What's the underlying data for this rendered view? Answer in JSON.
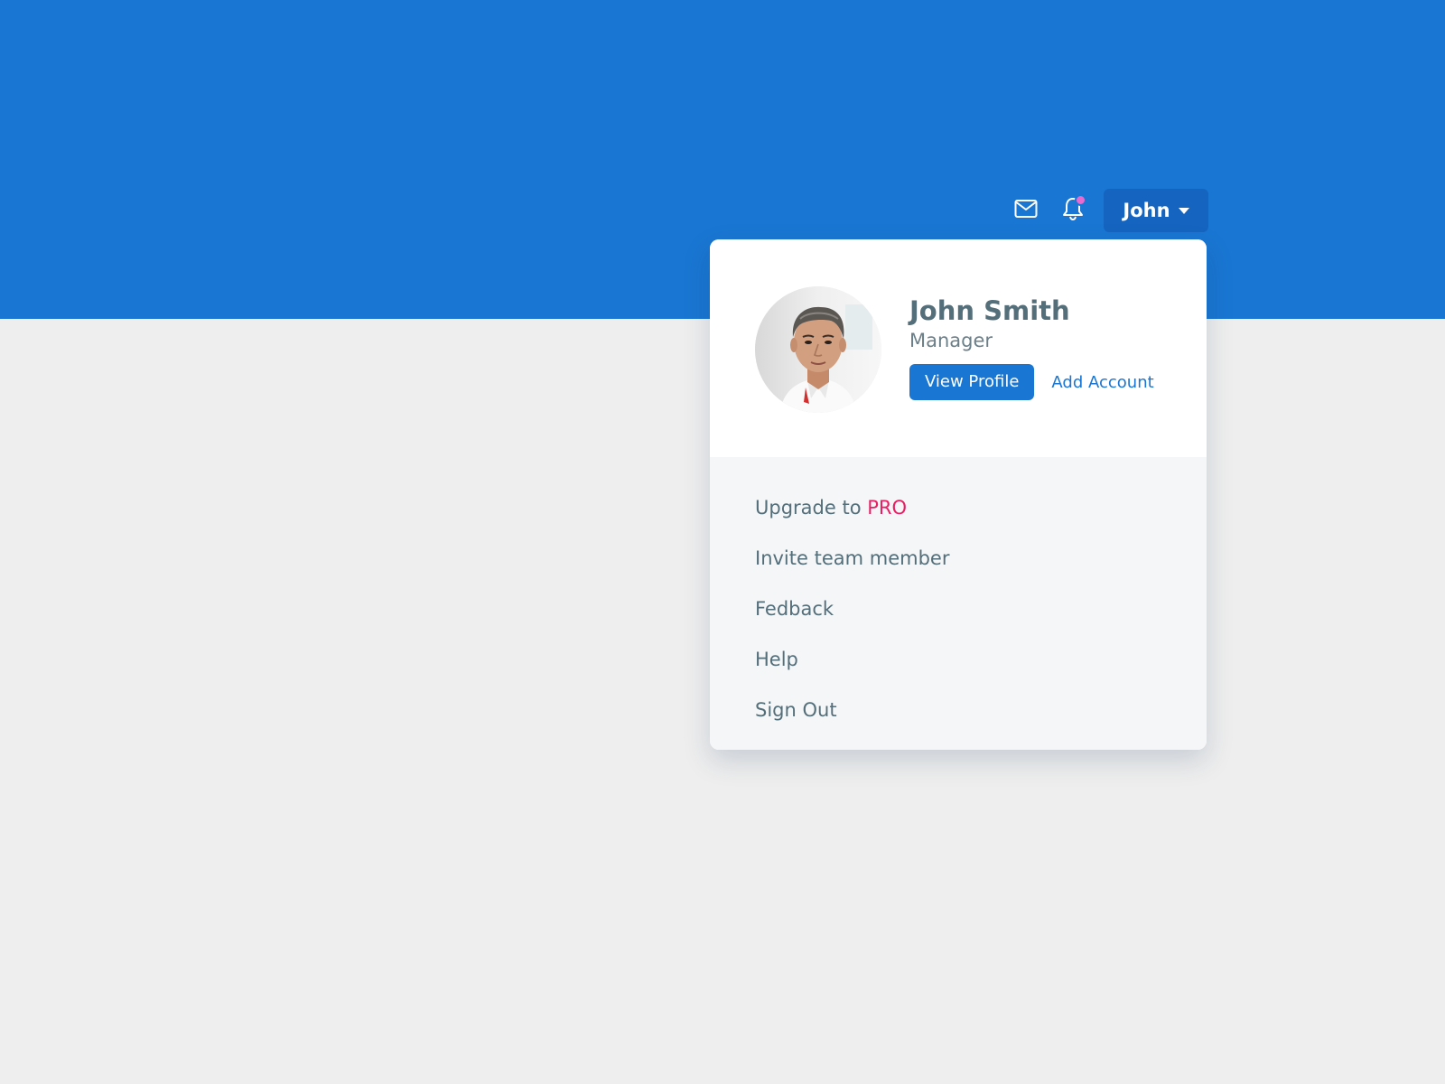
{
  "colors": {
    "primary": "#1976d2",
    "primary_dark": "#1565c0",
    "accent_pro": "#e91e63",
    "notification_dot": "#e66bd0",
    "background": "#eeeeee",
    "text": "#546e7a"
  },
  "topbar": {
    "mail_icon": "envelope-icon",
    "bell_icon": "bell-icon",
    "user_name": "John"
  },
  "profile": {
    "name": "John Smith",
    "role": "Manager",
    "view_profile_label": "View Profile",
    "add_account_label": "Add Account"
  },
  "menu": {
    "upgrade_prefix": "Upgrade to ",
    "upgrade_highlight": "PRO",
    "items": [
      "Invite team member",
      "Fedback",
      "Help",
      "Sign Out"
    ]
  }
}
